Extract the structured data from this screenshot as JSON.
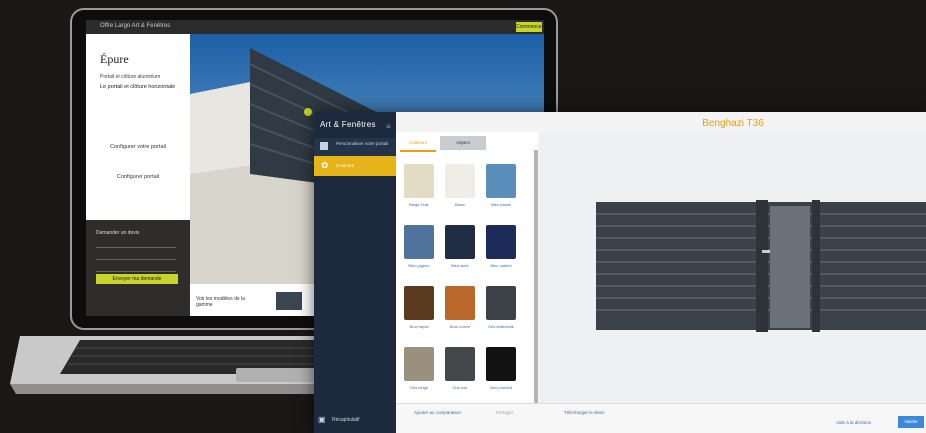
{
  "laptop": {
    "browser_title": "Offre Largo Art & Fenêtres",
    "browser_button": "Commencer",
    "logo": "Épure",
    "tagline": "Portail et clôture aluminium",
    "tagline2": "Le portail et clôture horizontale",
    "link1": "Configurer votre portail",
    "link2": "Configurer portail",
    "dark_title": "Demander un devis",
    "dark_button": "Envoyer ma demande",
    "bottom_caption": "Voir les modèles de la gamme"
  },
  "app": {
    "logo": "Art & Fenêtres",
    "title": "Benghazi T36",
    "sidebar": {
      "item1": "Personnaliser votre portail",
      "item2": "Couleurs",
      "bottom": "Récapitulatif"
    },
    "tabs": [
      "Couleurs",
      "Aspect"
    ],
    "swatches": [
      {
        "label": "Beige Clair",
        "color": "#e3dcc4"
      },
      {
        "label": "Blanc",
        "color": "#eeede6"
      },
      {
        "label": "Bleu pastel",
        "color": "#5b8ebb"
      },
      {
        "label": "Bleu pigeon",
        "color": "#50739e"
      },
      {
        "label": "Bleu acier",
        "color": "#1f2c42"
      },
      {
        "label": "Bleu marine",
        "color": "#1c2b57"
      },
      {
        "label": "Brun sépia",
        "color": "#5a3a1c"
      },
      {
        "label": "Brun cuivre",
        "color": "#b9672a"
      },
      {
        "label": "Gris anthracite",
        "color": "#3c4147"
      },
      {
        "label": "Gris beige",
        "color": "#9a907d"
      },
      {
        "label": "Gris noir",
        "color": "#45484b"
      },
      {
        "label": "Noir profond",
        "color": "#121212"
      }
    ],
    "bottom": {
      "link1": "Ajouter au comparateur",
      "link2": "Partager",
      "link3": "Télécharger le devis",
      "link4": "Aide à la décision",
      "button": "Valider"
    }
  }
}
